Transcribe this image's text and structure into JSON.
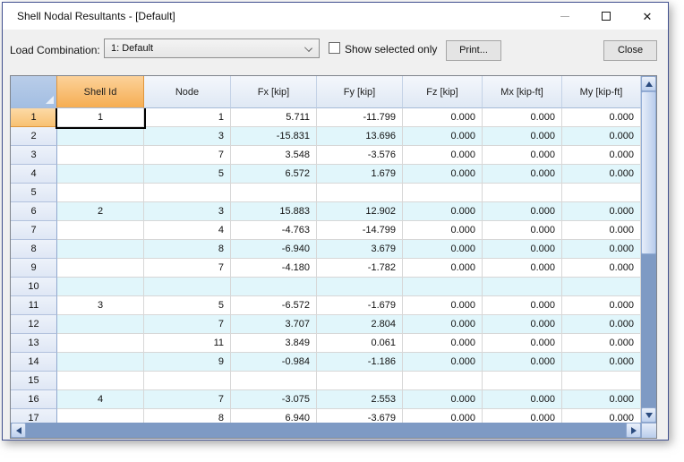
{
  "window": {
    "title": "Shell Nodal Resultants - [Default]"
  },
  "toolbar": {
    "load_combination_label": "Load Combination:",
    "load_combination_value": "1: Default",
    "show_selected_only_label": "Show selected only",
    "print_label": "Print...",
    "close_label": "Close"
  },
  "table": {
    "columns": [
      "Shell Id",
      "Node",
      "Fx [kip]",
      "Fy [kip]",
      "Fz [kip]",
      "Mx [kip-ft]",
      "My [kip-ft]"
    ],
    "selected_cell": {
      "row": 1,
      "column": "shell_id"
    },
    "rows": [
      {
        "num": "1",
        "shell_id": "1",
        "node": "1",
        "fx": "5.711",
        "fy": "-11.799",
        "fz": "0.000",
        "mx": "0.000",
        "my": "0.000"
      },
      {
        "num": "2",
        "shell_id": "",
        "node": "3",
        "fx": "-15.831",
        "fy": "13.696",
        "fz": "0.000",
        "mx": "0.000",
        "my": "0.000"
      },
      {
        "num": "3",
        "shell_id": "",
        "node": "7",
        "fx": "3.548",
        "fy": "-3.576",
        "fz": "0.000",
        "mx": "0.000",
        "my": "0.000"
      },
      {
        "num": "4",
        "shell_id": "",
        "node": "5",
        "fx": "6.572",
        "fy": "1.679",
        "fz": "0.000",
        "mx": "0.000",
        "my": "0.000"
      },
      {
        "num": "5",
        "shell_id": "",
        "node": "",
        "fx": "",
        "fy": "",
        "fz": "",
        "mx": "",
        "my": ""
      },
      {
        "num": "6",
        "shell_id": "2",
        "node": "3",
        "fx": "15.883",
        "fy": "12.902",
        "fz": "0.000",
        "mx": "0.000",
        "my": "0.000"
      },
      {
        "num": "7",
        "shell_id": "",
        "node": "4",
        "fx": "-4.763",
        "fy": "-14.799",
        "fz": "0.000",
        "mx": "0.000",
        "my": "0.000"
      },
      {
        "num": "8",
        "shell_id": "",
        "node": "8",
        "fx": "-6.940",
        "fy": "3.679",
        "fz": "0.000",
        "mx": "0.000",
        "my": "0.000"
      },
      {
        "num": "9",
        "shell_id": "",
        "node": "7",
        "fx": "-4.180",
        "fy": "-1.782",
        "fz": "0.000",
        "mx": "0.000",
        "my": "0.000"
      },
      {
        "num": "10",
        "shell_id": "",
        "node": "",
        "fx": "",
        "fy": "",
        "fz": "",
        "mx": "",
        "my": ""
      },
      {
        "num": "11",
        "shell_id": "3",
        "node": "5",
        "fx": "-6.572",
        "fy": "-1.679",
        "fz": "0.000",
        "mx": "0.000",
        "my": "0.000"
      },
      {
        "num": "12",
        "shell_id": "",
        "node": "7",
        "fx": "3.707",
        "fy": "2.804",
        "fz": "0.000",
        "mx": "0.000",
        "my": "0.000"
      },
      {
        "num": "13",
        "shell_id": "",
        "node": "11",
        "fx": "3.849",
        "fy": "0.061",
        "fz": "0.000",
        "mx": "0.000",
        "my": "0.000"
      },
      {
        "num": "14",
        "shell_id": "",
        "node": "9",
        "fx": "-0.984",
        "fy": "-1.186",
        "fz": "0.000",
        "mx": "0.000",
        "my": "0.000"
      },
      {
        "num": "15",
        "shell_id": "",
        "node": "",
        "fx": "",
        "fy": "",
        "fz": "",
        "mx": "",
        "my": ""
      },
      {
        "num": "16",
        "shell_id": "4",
        "node": "7",
        "fx": "-3.075",
        "fy": "2.553",
        "fz": "0.000",
        "mx": "0.000",
        "my": "0.000"
      },
      {
        "num": "17",
        "shell_id": "",
        "node": "8",
        "fx": "6.940",
        "fy": "-3.679",
        "fz": "0.000",
        "mx": "0.000",
        "my": "0.000"
      }
    ]
  },
  "colors": {
    "selected_column_orange": "#F5AD52",
    "header_blue": "#A3BEE2",
    "row_band_cyan": "#E1F6FB",
    "row_header_blue": "#E5EBF7",
    "scrollbar_track": "#7E9AC4",
    "scrollbar_thumb": "#C2D4EE",
    "window_border": "#41508F"
  }
}
